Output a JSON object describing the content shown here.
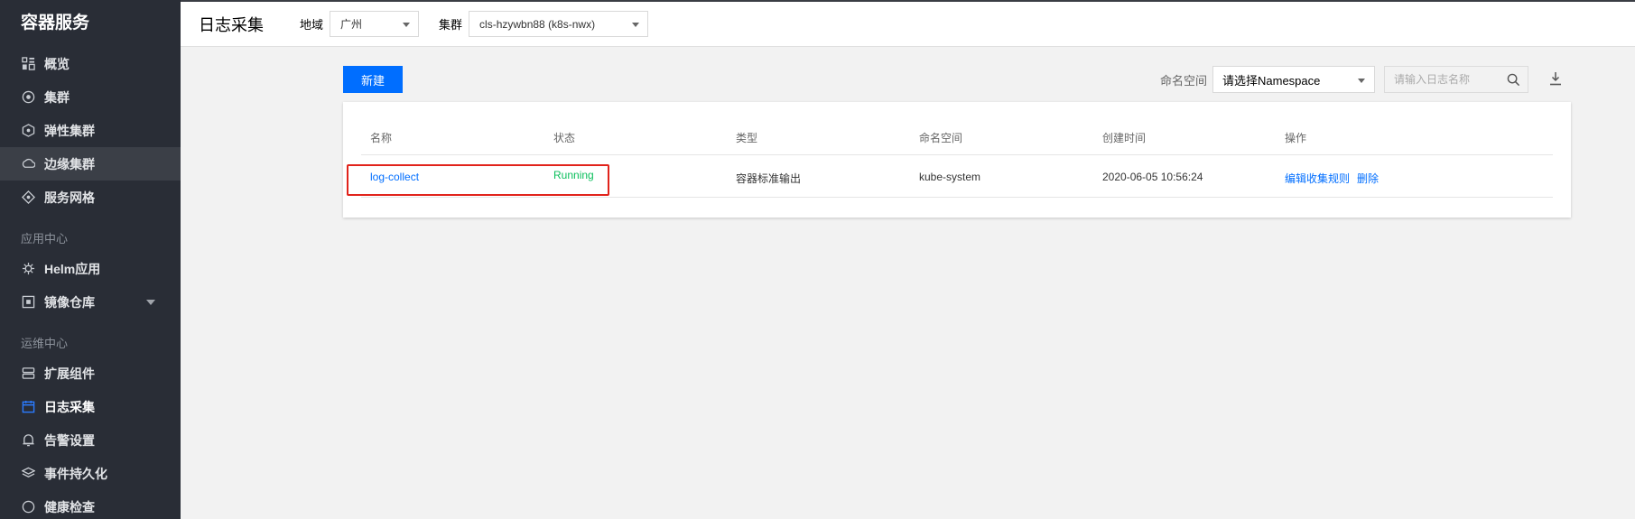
{
  "app": {
    "brand": "容器服务"
  },
  "sidebar": {
    "items": [
      {
        "label": "概览",
        "icon": "grid-icon"
      },
      {
        "label": "集群",
        "icon": "cluster-icon"
      },
      {
        "label": "弹性集群",
        "icon": "elastic-cluster-icon"
      },
      {
        "label": "边缘集群",
        "icon": "edge-cluster-icon"
      },
      {
        "label": "服务网格",
        "icon": "mesh-icon"
      }
    ],
    "group1": "应用中心",
    "group1_items": [
      {
        "label": "Helm应用",
        "icon": "helm-icon"
      },
      {
        "label": "镜像仓库",
        "icon": "image-repo-icon"
      }
    ],
    "group2": "运维中心",
    "group2_items": [
      {
        "label": "扩展组件",
        "icon": "addon-icon"
      },
      {
        "label": "日志采集",
        "icon": "log-icon"
      },
      {
        "label": "告警设置",
        "icon": "alarm-icon"
      },
      {
        "label": "事件持久化",
        "icon": "layers-icon"
      },
      {
        "label": "健康检查",
        "icon": "health-icon"
      }
    ]
  },
  "header": {
    "title": "日志采集",
    "region_label": "地域",
    "region_value": "广州",
    "cluster_label": "集群",
    "cluster_value": "cls-hzywbn88 (k8s-nwx)"
  },
  "toolbar": {
    "new_label": "新建",
    "namespace_label": "命名空间",
    "namespace_value": "请选择Namespace",
    "search_placeholder": "请输入日志名称"
  },
  "table": {
    "columns": [
      "名称",
      "状态",
      "类型",
      "命名空间",
      "创建时间",
      "操作"
    ],
    "rows": [
      {
        "name": "log-collect",
        "status": "Running",
        "type": "容器标准输出",
        "namespace": "kube-system",
        "created": "2020-06-05 10:56:24",
        "op_edit": "编辑收集规则",
        "op_delete": "删除"
      }
    ]
  },
  "colors": {
    "sidebar_bg": "#292d36",
    "primary": "#006eff",
    "running": "#0abf5b",
    "highlight": "#e1231b"
  }
}
